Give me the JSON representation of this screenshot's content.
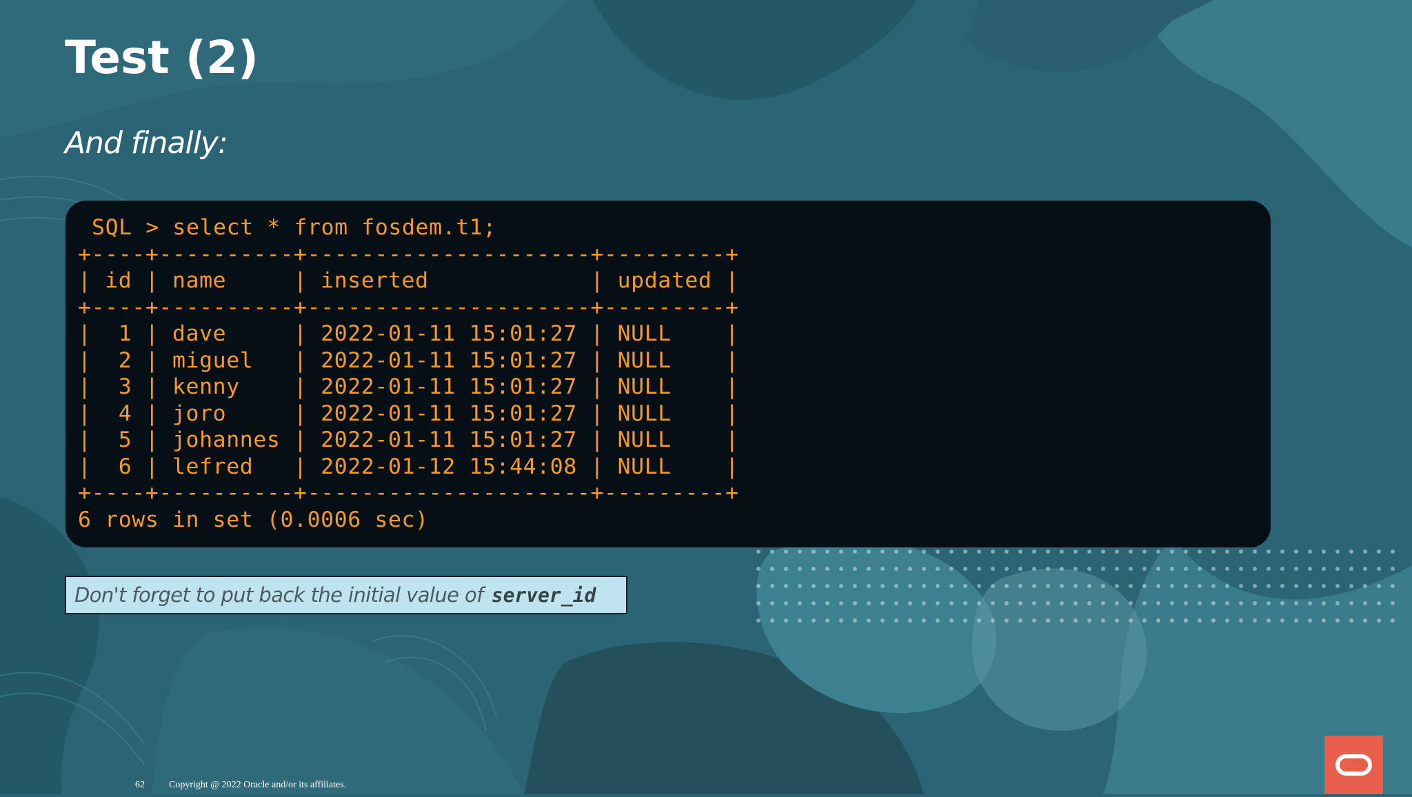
{
  "slide": {
    "title": "Test (2)",
    "subtitle": "And finally:",
    "page_number": "62",
    "copyright": "Copyright @ 2022 Oracle and/or its affiliates."
  },
  "terminal": {
    "prompt": "SQL > select * from fosdem.t1;",
    "border_line": "+----+----------+---------------------+---------+",
    "header_line": "| id | name     | inserted            | updated |",
    "rows": [
      "|  1 | dave     | 2022-01-11 15:01:27 | NULL    |",
      "|  2 | miguel   | 2022-01-11 15:01:27 | NULL    |",
      "|  3 | kenny    | 2022-01-11 15:01:27 | NULL    |",
      "|  4 | joro     | 2022-01-11 15:01:27 | NULL    |",
      "|  5 | johannes | 2022-01-11 15:01:27 | NULL    |",
      "|  6 | lefred   | 2022-01-12 15:44:08 | NULL    |"
    ],
    "footer": "6 rows in set (0.0006 sec)"
  },
  "note": {
    "text": "Don't forget to put back the initial value of",
    "code": "server_id"
  },
  "logo": {
    "icon": "oracle-logo-icon"
  },
  "colors": {
    "background": "#2b6474",
    "terminal_bg": "#060e16",
    "terminal_text": "#f59a24",
    "note_bg": "#bfe4f0",
    "logo_red": "#e8604c"
  }
}
